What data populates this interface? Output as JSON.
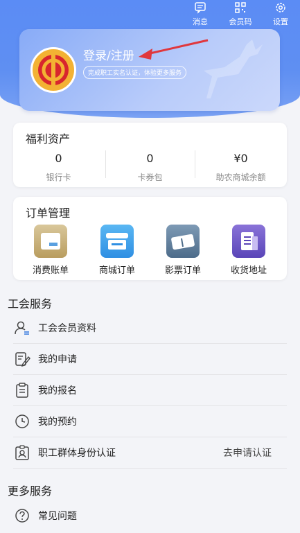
{
  "topbar": [
    {
      "label": "消息",
      "icon": "message-icon"
    },
    {
      "label": "会员码",
      "icon": "qrcode-icon"
    },
    {
      "label": "设置",
      "icon": "gear-icon"
    }
  ],
  "profile": {
    "login_label": "登录/注册",
    "subtitle": "完成职工实名认证，体验更多服务"
  },
  "assets": {
    "title": "福利资产",
    "items": [
      {
        "value": "0",
        "label": "银行卡"
      },
      {
        "value": "0",
        "label": "卡券包"
      },
      {
        "value": "¥0",
        "label": "助农商城余额"
      }
    ]
  },
  "orders": {
    "title": "订单管理",
    "items": [
      {
        "label": "消费账单",
        "icon": "bill-icon"
      },
      {
        "label": "商城订单",
        "icon": "shop-icon"
      },
      {
        "label": "影票订单",
        "icon": "ticket-icon"
      },
      {
        "label": "收货地址",
        "icon": "address-icon"
      }
    ]
  },
  "union_services": {
    "title": "工会服务",
    "items": [
      {
        "label": "工会会员资料",
        "icon": "member-profile-icon",
        "right": ""
      },
      {
        "label": "我的申请",
        "icon": "edit-form-icon",
        "right": ""
      },
      {
        "label": "我的报名",
        "icon": "clipboard-icon",
        "right": ""
      },
      {
        "label": "我的预约",
        "icon": "clock-icon",
        "right": ""
      },
      {
        "label": "职工群体身份认证",
        "icon": "id-badge-icon",
        "right": "去申请认证"
      }
    ]
  },
  "more_services": {
    "title": "更多服务",
    "items": [
      {
        "label": "常见问题",
        "icon": "question-icon"
      }
    ]
  },
  "colors": {
    "hero_blue": "#5b8cf5",
    "logo_gold": "#f3b233",
    "logo_red": "#d8262e",
    "arrow_red": "#e0373d"
  }
}
